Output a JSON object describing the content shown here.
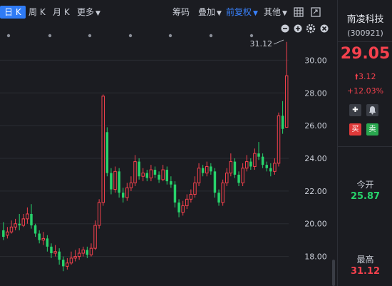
{
  "toolbar": {
    "tabs": [
      "日 K",
      "周 K",
      "月 K",
      "更多"
    ],
    "chip": "筹码",
    "overlay": "叠加",
    "adjust": "前复权",
    "other": "其他",
    "colors": {
      "active_tab_bg": "#2f7bf5",
      "adjust_text": "#3a83ff"
    }
  },
  "sidebar": {
    "name": "南凌科技",
    "code": "(300921)",
    "price": "29.05",
    "change": "3.12",
    "change_pct": "+12.03%",
    "add_icon": "plus-icon",
    "alert_icon": "bell-icon",
    "buy_label": "买",
    "sell_label": "卖",
    "open_label": "今开",
    "open_value": "25.87",
    "high_label": "最高",
    "high_value": "31.12",
    "colors": {
      "up": "#f5414d",
      "down": "#27d36b"
    }
  },
  "chart_data": {
    "type": "candlestick",
    "ylim": [
      16.5,
      31.5
    ],
    "y_ticks": [
      "30.00",
      "28.00",
      "26.00",
      "24.00",
      "22.00",
      "20.00",
      "18.00"
    ],
    "high_annotation": "31.12",
    "colors": {
      "up": "#f5414d",
      "down": "#27d36b",
      "bg": "#1b1c21",
      "grid": "#2a2c33"
    },
    "candles": [
      [
        19.6,
        19.2,
        20.1,
        19.0
      ],
      [
        19.3,
        19.5,
        19.8,
        19.1
      ],
      [
        19.5,
        19.8,
        20.2,
        19.4
      ],
      [
        19.8,
        20.0,
        20.3,
        19.6
      ],
      [
        20.0,
        19.9,
        20.6,
        19.6
      ],
      [
        19.9,
        20.3,
        20.6,
        19.8
      ],
      [
        20.3,
        20.6,
        21.0,
        20.0
      ],
      [
        20.6,
        19.9,
        21.2,
        19.7
      ],
      [
        19.9,
        19.4,
        20.0,
        19.2
      ],
      [
        19.4,
        19.0,
        19.6,
        18.8
      ],
      [
        19.0,
        19.1,
        19.5,
        18.7
      ],
      [
        19.1,
        18.6,
        19.3,
        18.3
      ],
      [
        18.6,
        18.2,
        18.8,
        17.9
      ],
      [
        18.2,
        18.3,
        18.7,
        18.0
      ],
      [
        18.3,
        17.8,
        18.5,
        17.5
      ],
      [
        17.8,
        17.4,
        18.0,
        17.1
      ],
      [
        17.4,
        17.6,
        17.9,
        17.2
      ],
      [
        17.6,
        17.9,
        18.3,
        17.5
      ],
      [
        17.9,
        18.0,
        18.4,
        17.7
      ],
      [
        18.0,
        18.2,
        18.5,
        17.8
      ],
      [
        18.2,
        18.4,
        18.6,
        18.0
      ],
      [
        18.4,
        18.1,
        18.6,
        17.9
      ],
      [
        18.1,
        18.5,
        18.8,
        18.0
      ],
      [
        18.5,
        19.9,
        20.2,
        18.4
      ],
      [
        19.9,
        21.3,
        21.5,
        19.7
      ],
      [
        21.3,
        27.8,
        27.9,
        21.1
      ],
      [
        25.6,
        23.1,
        25.9,
        22.9
      ],
      [
        23.1,
        22.1,
        23.4,
        21.8
      ],
      [
        22.1,
        23.2,
        23.5,
        21.9
      ],
      [
        23.2,
        21.9,
        23.4,
        21.6
      ],
      [
        21.9,
        21.6,
        22.2,
        21.3
      ],
      [
        21.6,
        22.2,
        22.5,
        21.4
      ],
      [
        22.2,
        22.5,
        22.9,
        22.0
      ],
      [
        22.5,
        23.8,
        24.2,
        22.3
      ],
      [
        23.8,
        22.9,
        24.0,
        22.7
      ],
      [
        22.9,
        23.1,
        23.4,
        22.6
      ],
      [
        23.1,
        22.8,
        23.3,
        22.6
      ],
      [
        22.8,
        23.3,
        23.6,
        22.6
      ],
      [
        23.3,
        23.0,
        23.5,
        22.8
      ],
      [
        23.0,
        22.7,
        23.2,
        22.5
      ],
      [
        22.7,
        23.3,
        23.6,
        22.6
      ],
      [
        23.3,
        22.6,
        23.5,
        22.4
      ],
      [
        22.6,
        22.4,
        22.9,
        22.2
      ],
      [
        22.4,
        21.3,
        22.6,
        21.0
      ],
      [
        21.3,
        20.7,
        21.5,
        20.4
      ],
      [
        20.7,
        21.1,
        21.4,
        20.5
      ],
      [
        21.1,
        21.5,
        21.8,
        20.9
      ],
      [
        21.5,
        21.8,
        22.1,
        21.3
      ],
      [
        21.8,
        22.5,
        22.9,
        21.6
      ],
      [
        22.5,
        23.4,
        23.7,
        22.3
      ],
      [
        23.4,
        23.1,
        23.6,
        22.9
      ],
      [
        23.1,
        23.5,
        23.8,
        22.9
      ],
      [
        23.5,
        23.2,
        23.7,
        23.0
      ],
      [
        23.2,
        21.9,
        23.4,
        21.6
      ],
      [
        21.9,
        21.3,
        22.1,
        21.1
      ],
      [
        21.3,
        22.5,
        22.7,
        21.1
      ],
      [
        22.5,
        23.1,
        23.4,
        22.3
      ],
      [
        23.1,
        23.8,
        24.3,
        22.9
      ],
      [
        23.8,
        23.0,
        24.0,
        22.8
      ],
      [
        23.0,
        22.5,
        23.2,
        22.3
      ],
      [
        22.5,
        23.4,
        23.7,
        22.3
      ],
      [
        23.4,
        23.8,
        24.2,
        23.2
      ],
      [
        23.8,
        23.5,
        24.0,
        23.3
      ],
      [
        23.5,
        24.3,
        24.6,
        23.3
      ],
      [
        24.3,
        24.1,
        25.0,
        23.9
      ],
      [
        24.1,
        23.6,
        24.3,
        23.4
      ],
      [
        23.6,
        23.4,
        23.8,
        23.2
      ],
      [
        23.4,
        23.2,
        23.7,
        22.9
      ],
      [
        23.2,
        23.7,
        24.0,
        23.0
      ],
      [
        23.7,
        26.6,
        26.8,
        23.5
      ],
      [
        26.6,
        25.8,
        27.5,
        25.5
      ],
      [
        25.9,
        29.05,
        31.12,
        25.87
      ]
    ]
  }
}
